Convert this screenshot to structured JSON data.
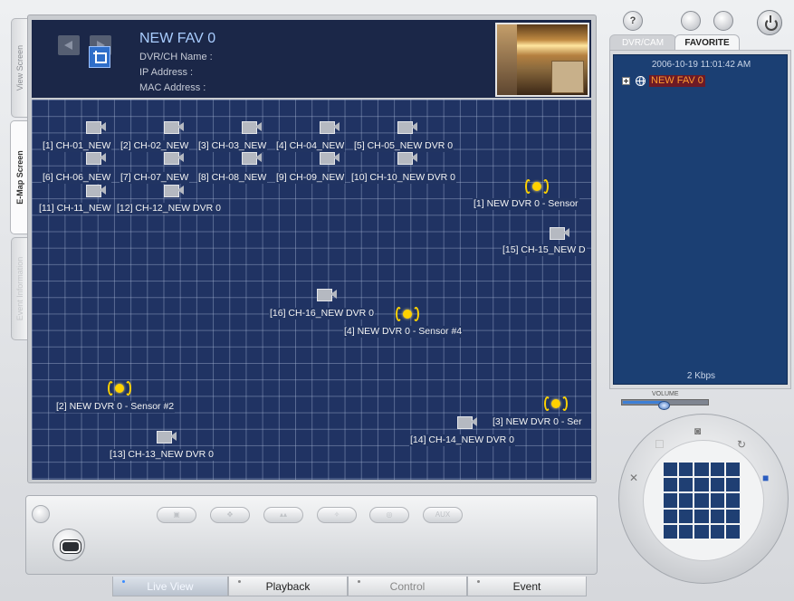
{
  "left_tabs": [
    {
      "label": "View Screen"
    },
    {
      "label": "E-Map Screen"
    },
    {
      "label": "Event Information"
    }
  ],
  "header": {
    "title": "NEW FAV 0",
    "dvr_ch_name_label": "DVR/CH Name :",
    "ip_label": "IP Address :",
    "mac_label": "MAC Address :"
  },
  "map": {
    "cameras": [
      {
        "label": "[1] CH-01_NEW"
      },
      {
        "label": "[2] CH-02_NEW"
      },
      {
        "label": "[3] CH-03_NEW"
      },
      {
        "label": "[4] CH-04_NEW"
      },
      {
        "label": "[5] CH-05_NEW DVR 0"
      },
      {
        "label": "[6] CH-06_NEW"
      },
      {
        "label": "[7] CH-07_NEW"
      },
      {
        "label": "[8] CH-08_NEW"
      },
      {
        "label": "[9] CH-09_NEW"
      },
      {
        "label": "[10] CH-10_NEW DVR 0"
      },
      {
        "label": "[11] CH-11_NEW"
      },
      {
        "label": "[12] CH-12_NEW DVR 0"
      },
      {
        "label": "[15] CH-15_NEW D"
      },
      {
        "label": "[16] CH-16_NEW DVR 0"
      },
      {
        "label": "[14] CH-14_NEW DVR 0"
      },
      {
        "label": "[13] CH-13_NEW DVR 0"
      }
    ],
    "sensors": [
      {
        "label": "[1] NEW DVR 0 - Sensor"
      },
      {
        "label": "[4] NEW DVR 0 - Sensor #4"
      },
      {
        "label": "[2] NEW DVR 0 - Sensor #2"
      },
      {
        "label": "[3] NEW DVR 0 - Ser"
      }
    ]
  },
  "top_buttons": [
    "?"
  ],
  "right_tabs": {
    "inactive": "DVR/CAM",
    "active": "FAVORITE"
  },
  "tree": {
    "timestamp": "2006-10-19 11:01:42 AM",
    "node": "NEW FAV 0",
    "bitrate": "2 Kbps"
  },
  "volume": {
    "label": "VOLUME",
    "level": 0.47
  },
  "control_buttons": [
    "AUX"
  ],
  "bottom_tabs": [
    {
      "label": "Live View"
    },
    {
      "label": "Playback"
    },
    {
      "label": "Control"
    },
    {
      "label": "Event"
    }
  ]
}
